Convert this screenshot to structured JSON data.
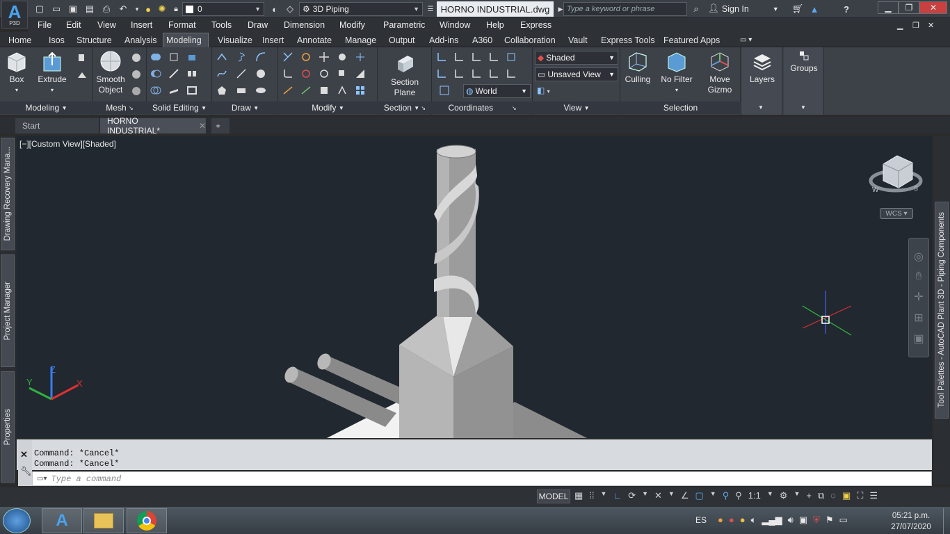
{
  "app": {
    "logo_letter": "A",
    "logo_sub": "P3D"
  },
  "quick_access": {
    "layer_value": "0",
    "workspace": "3D Piping"
  },
  "document_title": "HORNO INDUSTRIAL.dwg",
  "search": {
    "placeholder": "Type a keyword or phrase"
  },
  "sign_in": "Sign In",
  "menus": [
    "File",
    "Edit",
    "View",
    "Insert",
    "Format",
    "Tools",
    "Draw",
    "Dimension",
    "Modify",
    "Parametric",
    "Window",
    "Help",
    "Express"
  ],
  "ribbon_tabs": [
    "Home",
    "Isos",
    "Structure",
    "Analysis",
    "Modeling",
    "Visualize",
    "Insert",
    "Annotate",
    "Manage",
    "Output",
    "Add-ins",
    "A360",
    "Collaboration",
    "Vault",
    "Express Tools",
    "Featured Apps"
  ],
  "active_tab": "Modeling",
  "ribbon": {
    "box": "Box",
    "extrude": "Extrude",
    "smooth_object": [
      "Smooth",
      "Object"
    ],
    "section_plane": [
      "Section",
      "Plane"
    ],
    "visual_style": "Shaded",
    "named_view": "Unsaved View",
    "ucs": "World",
    "culling": "Culling",
    "no_filter": "No Filter",
    "move_gizmo": [
      "Move",
      "Gizmo"
    ],
    "layers": "Layers",
    "groups": "Groups",
    "panels": [
      "Modeling",
      "Mesh",
      "Solid Editing",
      "Draw",
      "Modify",
      "Section",
      "Coordinates",
      "View",
      "Selection"
    ]
  },
  "file_tabs": [
    "Start",
    "HORNO INDUSTRIAL*"
  ],
  "viewport_label": "[−][Custom View][Shaded]",
  "viewcube": {
    "wcs": "WCS"
  },
  "left_palettes": [
    "Drawing Recovery Mana...",
    "Project Manager",
    "Properties"
  ],
  "right_palette": "Tool Palettes - AutoCAD Plant 3D - Piping Components",
  "command_history": [
    "Command: *Cancel*",
    "Command: *Cancel*"
  ],
  "command_placeholder": "Type a command",
  "status": {
    "model": "MODEL",
    "scale": "1:1"
  },
  "taskbar": {
    "lang": "ES",
    "time": "05:21 p.m.",
    "date": "27/07/2020"
  },
  "colors": {
    "accent_blue": "#4aa3f0",
    "viewport_bg": "#212830",
    "ribbon_bg": "#3d4148"
  }
}
